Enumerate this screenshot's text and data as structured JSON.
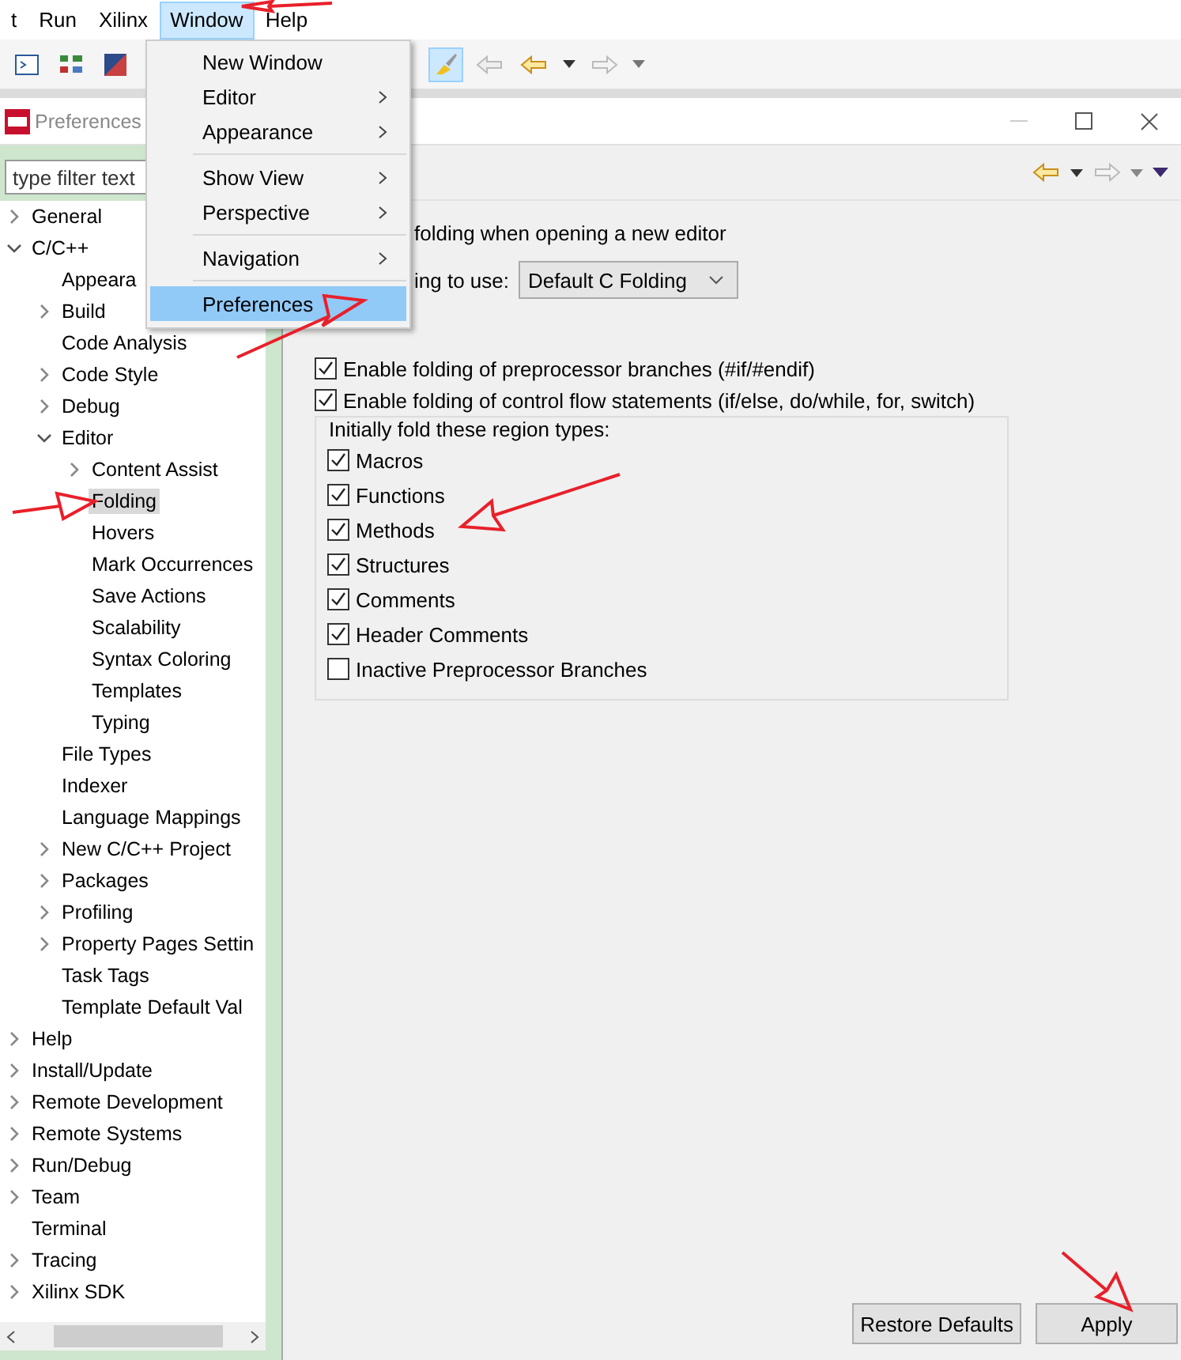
{
  "menubar": [
    {
      "label": "t",
      "selected": false
    },
    {
      "label": "Run",
      "selected": false
    },
    {
      "label": "Xilinx",
      "selected": false
    },
    {
      "label": "Window",
      "selected": true
    },
    {
      "label": "Help",
      "selected": false
    }
  ],
  "toolbar": {
    "highlight_toggle": {
      "on": true
    }
  },
  "window_menu": [
    {
      "kind": "item",
      "label": "New Window",
      "submenu": false,
      "selected": false
    },
    {
      "kind": "item",
      "label": "Editor",
      "submenu": true,
      "selected": false
    },
    {
      "kind": "item",
      "label": "Appearance",
      "submenu": true,
      "selected": false
    },
    {
      "kind": "separator"
    },
    {
      "kind": "item",
      "label": "Show View",
      "submenu": true,
      "selected": false
    },
    {
      "kind": "item",
      "label": "Perspective",
      "submenu": true,
      "selected": false
    },
    {
      "kind": "separator"
    },
    {
      "kind": "item",
      "label": "Navigation",
      "submenu": true,
      "selected": false
    },
    {
      "kind": "separator"
    },
    {
      "kind": "item",
      "label": "Preferences",
      "submenu": false,
      "selected": true
    }
  ],
  "dialog": {
    "title": "Preferences",
    "filter": {
      "placeholder": "type filter text"
    },
    "tree": [
      {
        "label": "General",
        "kind": "folder",
        "expanded": false,
        "selected": false
      },
      {
        "label": "C/C++",
        "kind": "folder",
        "expanded": true,
        "selected": false,
        "children": [
          {
            "label": "Appeara",
            "kind": "leaf",
            "selected": false
          },
          {
            "label": "Build",
            "kind": "folder",
            "expanded": false,
            "selected": false
          },
          {
            "label": "Code Analysis",
            "kind": "leaf",
            "selected": false
          },
          {
            "label": "Code Style",
            "kind": "folder",
            "expanded": false,
            "selected": false
          },
          {
            "label": "Debug",
            "kind": "folder",
            "expanded": false,
            "selected": false
          },
          {
            "label": "Editor",
            "kind": "folder",
            "expanded": true,
            "selected": false,
            "children": [
              {
                "label": "Content Assist",
                "kind": "folder",
                "expanded": false,
                "selected": false
              },
              {
                "label": "Folding",
                "kind": "leaf",
                "selected": true
              },
              {
                "label": "Hovers",
                "kind": "leaf",
                "selected": false
              },
              {
                "label": "Mark Occurrences",
                "kind": "leaf",
                "selected": false
              },
              {
                "label": "Save Actions",
                "kind": "leaf",
                "selected": false
              },
              {
                "label": "Scalability",
                "kind": "leaf",
                "selected": false
              },
              {
                "label": "Syntax Coloring",
                "kind": "leaf",
                "selected": false
              },
              {
                "label": "Templates",
                "kind": "leaf",
                "selected": false
              },
              {
                "label": "Typing",
                "kind": "leaf",
                "selected": false
              }
            ]
          },
          {
            "label": "File Types",
            "kind": "leaf",
            "selected": false
          },
          {
            "label": "Indexer",
            "kind": "leaf",
            "selected": false
          },
          {
            "label": "Language Mappings",
            "kind": "leaf",
            "selected": false
          },
          {
            "label": "New C/C++ Project",
            "kind": "folder",
            "expanded": false,
            "selected": false
          },
          {
            "label": "Packages",
            "kind": "folder",
            "expanded": false,
            "selected": false
          },
          {
            "label": "Profiling",
            "kind": "folder",
            "expanded": false,
            "selected": false
          },
          {
            "label": "Property Pages Settin",
            "kind": "folder",
            "expanded": false,
            "selected": false
          },
          {
            "label": "Task Tags",
            "kind": "leaf",
            "selected": false
          },
          {
            "label": "Template Default Val",
            "kind": "leaf",
            "selected": false
          }
        ]
      },
      {
        "label": "Help",
        "kind": "folder",
        "expanded": false,
        "selected": false
      },
      {
        "label": "Install/Update",
        "kind": "folder",
        "expanded": false,
        "selected": false
      },
      {
        "label": "Remote Development",
        "kind": "folder",
        "expanded": false,
        "selected": false
      },
      {
        "label": "Remote Systems",
        "kind": "folder",
        "expanded": false,
        "selected": false
      },
      {
        "label": "Run/Debug",
        "kind": "folder",
        "expanded": false,
        "selected": false
      },
      {
        "label": "Team",
        "kind": "folder",
        "expanded": false,
        "selected": false
      },
      {
        "label": "Terminal",
        "kind": "leaf",
        "selected": false
      },
      {
        "label": "Tracing",
        "kind": "folder",
        "expanded": false,
        "selected": false
      },
      {
        "label": "Xilinx SDK",
        "kind": "folder",
        "expanded": false,
        "selected": false
      }
    ],
    "page": {
      "open_option": "folding when opening a new editor",
      "combo": {
        "label": "ing to use:",
        "value": "Default C Folding"
      },
      "options": [
        {
          "label": "Enable folding of preprocessor branches (#if/#endif)",
          "checked": true
        },
        {
          "label": "Enable folding of control flow statements (if/else, do/while, for, switch)",
          "checked": true
        }
      ],
      "group": {
        "title": "Initially fold these region types:",
        "items": [
          {
            "label": "Macros",
            "checked": true
          },
          {
            "label": "Functions",
            "checked": true
          },
          {
            "label": "Methods",
            "checked": true
          },
          {
            "label": "Structures",
            "checked": true
          },
          {
            "label": "Comments",
            "checked": true
          },
          {
            "label": "Header Comments",
            "checked": true
          },
          {
            "label": "Inactive Preprocessor Branches",
            "checked": false
          }
        ]
      }
    },
    "buttons": [
      "Restore Defaults",
      "Apply"
    ]
  }
}
